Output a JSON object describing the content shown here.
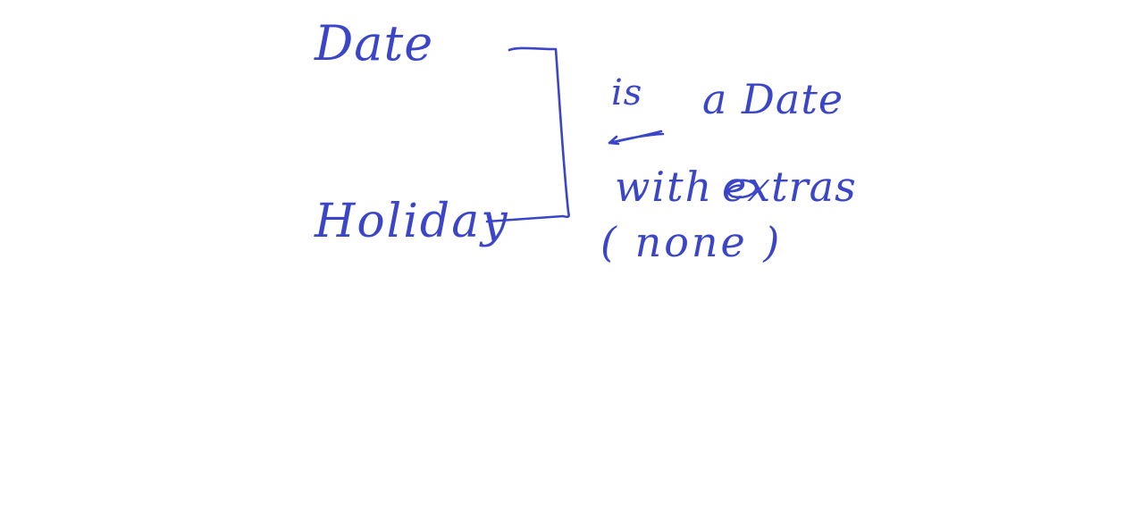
{
  "canvas": {
    "background": "#ffffff",
    "ink_color": "#3a45c8"
  },
  "entities": {
    "date_label": "Date",
    "holiday_label": "Holiday"
  },
  "relation": {
    "is_label": "is",
    "target_label": "a Date",
    "extras_prefix": "with",
    "extras_label": "extras",
    "extras_note": "( none )"
  }
}
